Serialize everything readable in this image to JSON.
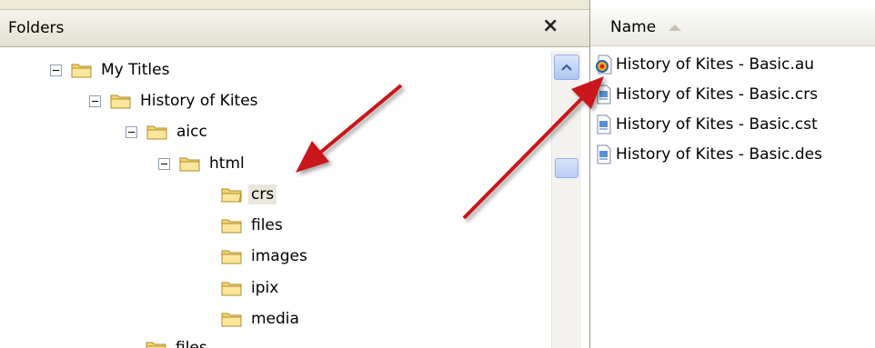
{
  "folders_pane": {
    "title": "Folders",
    "close_label": "×",
    "tree": [
      {
        "label": "My Titles",
        "expanded": true
      },
      {
        "label": "History of Kites",
        "expanded": true
      },
      {
        "label": "aicc",
        "expanded": true
      },
      {
        "label": "html",
        "expanded": true
      },
      {
        "label": "crs",
        "selected": true
      },
      {
        "label": "files"
      },
      {
        "label": "images"
      },
      {
        "label": "ipix"
      },
      {
        "label": "media"
      },
      {
        "label": "files"
      }
    ]
  },
  "files_pane": {
    "column_name": "Name",
    "files": [
      {
        "label": "History of Kites - Basic.au",
        "icon": "audio-file-icon"
      },
      {
        "label": "History of Kites - Basic.crs",
        "icon": "document-file-icon"
      },
      {
        "label": "History of Kites - Basic.cst",
        "icon": "document-file-icon"
      },
      {
        "label": "History of Kites - Basic.des",
        "icon": "document-file-icon"
      }
    ]
  },
  "colors": {
    "folder": "#f5d572",
    "annotation_arrow": "#c8141c",
    "selection": "#e9e7dc"
  }
}
